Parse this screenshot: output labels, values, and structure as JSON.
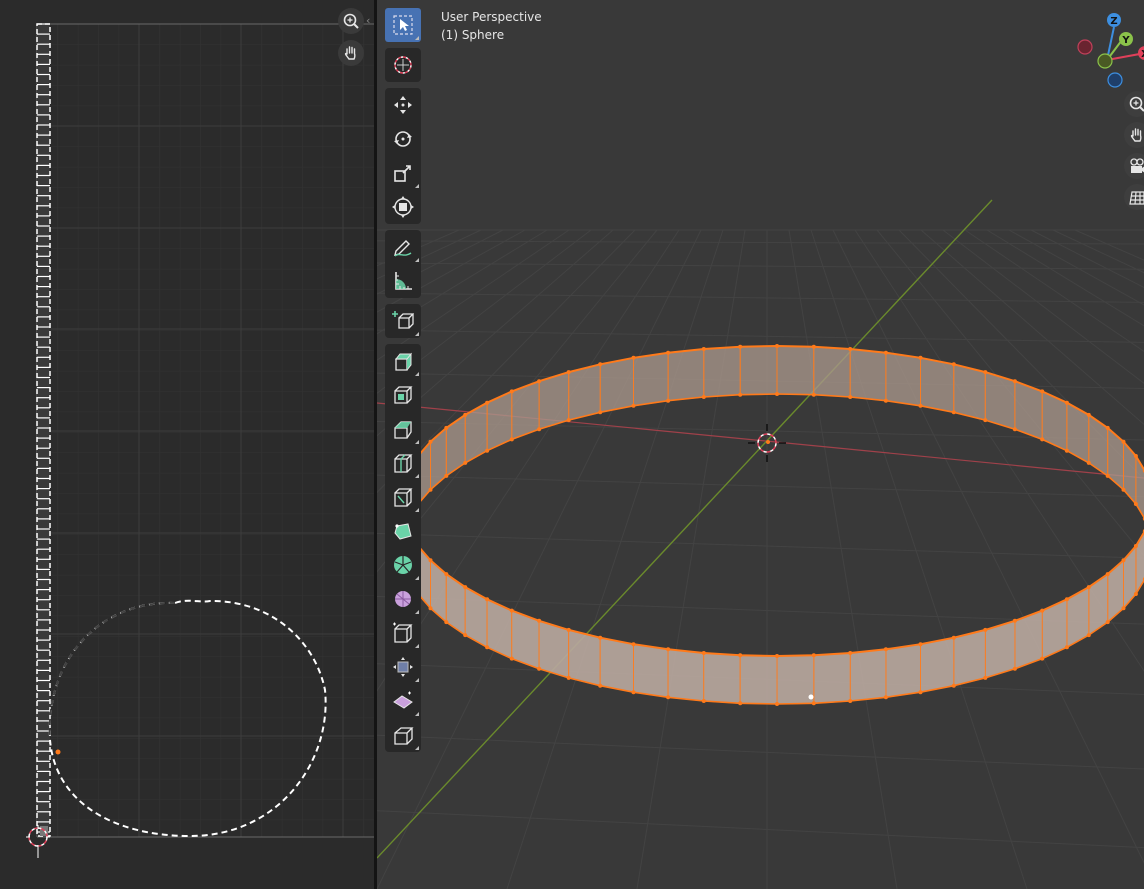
{
  "viewport": {
    "view_name": "User Perspective",
    "object_name": "(1) Sphere"
  },
  "uv_editor": {
    "nav_icons": [
      "zoom-icon",
      "pan-hand-icon"
    ]
  },
  "toolbar": {
    "tools": [
      {
        "name": "tool-select-box",
        "icon": "select-box-icon",
        "active": true
      },
      {
        "name": "tool-cursor",
        "icon": "cursor-icon"
      },
      {
        "name": "tool-move",
        "icon": "move-icon"
      },
      {
        "name": "tool-rotate",
        "icon": "rotate-icon"
      },
      {
        "name": "tool-scale",
        "icon": "scale-icon"
      },
      {
        "name": "tool-transform",
        "icon": "transform-icon"
      },
      {
        "name": "tool-annotate",
        "icon": "annotate-icon"
      },
      {
        "name": "tool-measure",
        "icon": "measure-icon"
      },
      {
        "name": "tool-add-cube",
        "icon": "add-cube-icon"
      },
      {
        "name": "tool-extrude",
        "icon": "extrude-icon"
      },
      {
        "name": "tool-inset",
        "icon": "inset-icon"
      },
      {
        "name": "tool-bevel",
        "icon": "bevel-icon"
      },
      {
        "name": "tool-loop-cut",
        "icon": "loop-cut-icon"
      },
      {
        "name": "tool-knife",
        "icon": "knife-icon"
      },
      {
        "name": "tool-poly-build",
        "icon": "poly-build-icon"
      },
      {
        "name": "tool-spin",
        "icon": "spin-icon"
      },
      {
        "name": "tool-smooth",
        "icon": "smooth-icon"
      },
      {
        "name": "tool-edge-slide",
        "icon": "edge-slide-icon"
      },
      {
        "name": "tool-shrink-fatten",
        "icon": "shrink-fatten-icon"
      },
      {
        "name": "tool-shear",
        "icon": "shear-icon"
      },
      {
        "name": "tool-rip-region",
        "icon": "rip-region-icon"
      }
    ]
  },
  "gizmo": {
    "axis_x": "X",
    "axis_y": "Y",
    "axis_z": "Z",
    "colors": {
      "x": "#e0405a",
      "y": "#8bc34a",
      "z": "#3d8fe0"
    }
  },
  "viewport_nav": [
    "zoom-icon",
    "pan-hand-icon",
    "camera-icon",
    "grid-view-icon"
  ],
  "colors": {
    "accent": "#4772b3",
    "selection": "#ff7a1a",
    "uv_edge": "#ffffff"
  }
}
